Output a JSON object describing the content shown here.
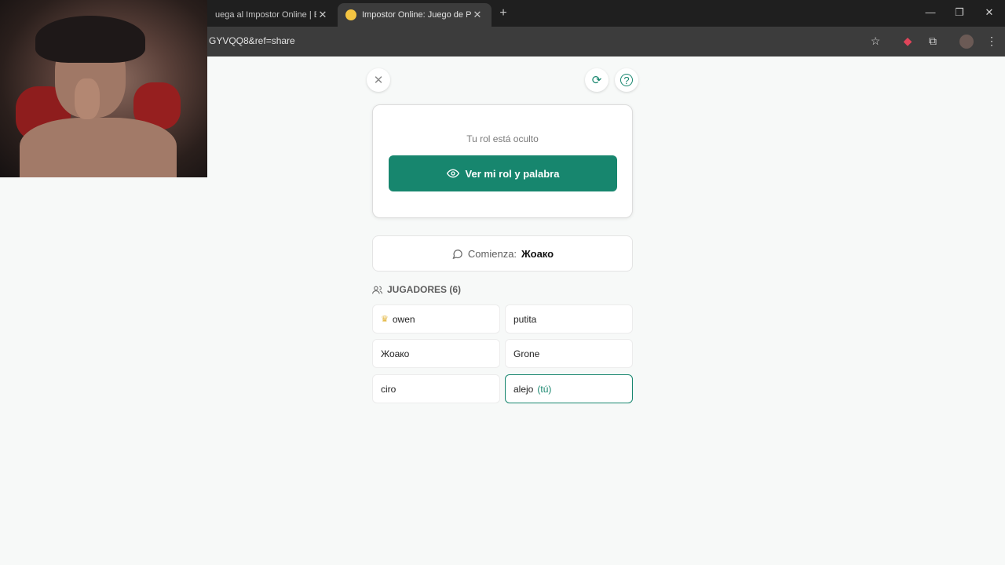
{
  "browser": {
    "tabs": [
      {
        "title": "uega al Impostor Online | Encu",
        "active": false
      },
      {
        "title": "Impostor Online: Juego de Pala",
        "active": true
      }
    ],
    "url": "GYVQQ8&ref=share"
  },
  "game": {
    "role_status": "Tu rol está oculto",
    "reveal_button": "Ver mi rol y palabra",
    "starts_label": "Comienza:",
    "starts_player": "Жоако",
    "players_header": "JUGADORES (6)",
    "you_tag": "(tú)",
    "players": [
      {
        "name": "owen",
        "host": true
      },
      {
        "name": "putita"
      },
      {
        "name": "Жоако"
      },
      {
        "name": "Grone"
      },
      {
        "name": "ciro"
      },
      {
        "name": "alejo",
        "is_you": true
      }
    ]
  },
  "colors": {
    "accent": "#17866e",
    "background": "#f7f9f8"
  }
}
